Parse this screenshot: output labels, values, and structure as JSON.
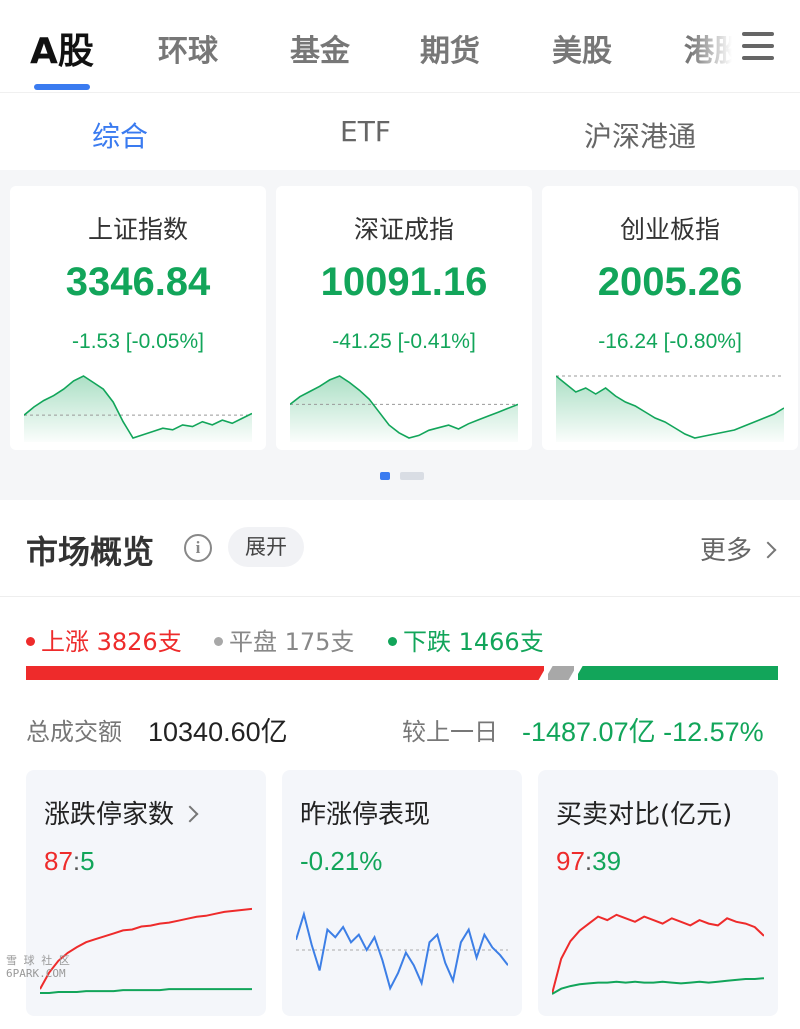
{
  "top_tabs": [
    {
      "label": "A股",
      "active": true
    },
    {
      "label": "环球",
      "active": false
    },
    {
      "label": "基金",
      "active": false
    },
    {
      "label": "期货",
      "active": false
    },
    {
      "label": "美股",
      "active": false
    },
    {
      "label": "港股",
      "active": false
    }
  ],
  "sub_tabs": [
    {
      "label": "综合",
      "active": true
    },
    {
      "label": "ETF",
      "active": false
    },
    {
      "label": "沪深港通",
      "active": false
    }
  ],
  "indices": [
    {
      "name": "上证指数",
      "value": "3346.84",
      "change": "-1.53 [-0.05%]"
    },
    {
      "name": "深证成指",
      "value": "10091.16",
      "change": "-41.25 [-0.41%]"
    },
    {
      "name": "创业板指",
      "value": "2005.26",
      "change": "-16.24 [-0.80%]"
    }
  ],
  "market": {
    "title": "市场概览",
    "expand_label": "展开",
    "more_label": "更多",
    "up_label": "上涨 3826支",
    "flat_label": "平盘 175支",
    "down_label": "下跌 1466支",
    "turnover_label": "总成交额",
    "turnover_value": "10340.60亿",
    "compare_label": "较上一日",
    "compare_value": "-1487.07亿 -12.57%"
  },
  "mini_cards": [
    {
      "title": "涨跌停家数",
      "value": "87:5"
    },
    {
      "title": "昨涨停表现",
      "value": "-0.21%"
    },
    {
      "title": "买卖对比(亿元)",
      "value": "97:39"
    }
  ],
  "watermark": {
    "line1": "雪 球 社 区",
    "line2": "6PARK.COM"
  },
  "colors": {
    "up": "#ee2b2b",
    "down": "#12a55a",
    "flat": "#a8a8a8",
    "accent": "#3a7bf0",
    "blue_line": "#3d7fe6"
  },
  "chart_data": [
    {
      "type": "line",
      "series": [
        {
          "values": [
            0,
            0.5,
            0.9,
            1.2,
            1.6,
            2.1,
            2.4,
            2.0,
            1.6,
            0.8,
            -0.4,
            -1.4,
            -1.2,
            -1.0,
            -0.8,
            -0.9,
            -0.6,
            -0.7,
            -0.4,
            -0.6,
            -0.3,
            -0.5,
            -0.2,
            0.1
          ]
        }
      ]
    },
    {
      "type": "line",
      "series": [
        {
          "values": [
            0,
            0.6,
            1.0,
            1.4,
            1.9,
            2.2,
            1.7,
            1.1,
            0.4,
            -0.6,
            -1.6,
            -2.2,
            -2.6,
            -2.4,
            -2.0,
            -1.8,
            -1.6,
            -1.9,
            -1.5,
            -1.2,
            -0.9,
            -0.6,
            -0.3,
            0.0
          ]
        }
      ]
    },
    {
      "type": "line",
      "series": [
        {
          "values": [
            0,
            -0.4,
            -0.8,
            -0.6,
            -0.9,
            -0.6,
            -1.0,
            -1.3,
            -1.5,
            -1.8,
            -2.1,
            -2.3,
            -2.6,
            -2.9,
            -3.1,
            -3.0,
            -2.9,
            -2.8,
            -2.7,
            -2.5,
            -2.3,
            -2.1,
            -1.9,
            -1.6
          ]
        }
      ]
    },
    {
      "type": "line",
      "series": [
        {
          "values": [
            5,
            22,
            34,
            42,
            48,
            53,
            56,
            59,
            62,
            65,
            66,
            69,
            70,
            72,
            73,
            75,
            77,
            79,
            80,
            82,
            84,
            85,
            86,
            87
          ]
        },
        {
          "values": [
            1,
            1,
            2,
            2,
            2,
            3,
            3,
            3,
            3,
            4,
            4,
            4,
            4,
            4,
            5,
            5,
            5,
            5,
            5,
            5,
            5,
            5,
            5,
            5
          ]
        }
      ]
    },
    {
      "type": "line",
      "series": [
        {
          "values": [
            0.4,
            1.4,
            0.2,
            -0.8,
            0.8,
            0.5,
            0.9,
            0.3,
            0.6,
            0.0,
            0.5,
            -0.4,
            -1.5,
            -0.9,
            -0.1,
            -0.6,
            -1.3,
            0.3,
            0.6,
            -0.5,
            -1.2,
            0.3,
            0.8,
            -0.3,
            0.6,
            0.1,
            -0.2,
            -0.6
          ]
        }
      ]
    },
    {
      "type": "line",
      "series": [
        {
          "values": [
            0,
            40,
            60,
            72,
            80,
            88,
            84,
            90,
            86,
            82,
            88,
            84,
            80,
            86,
            82,
            78,
            84,
            80,
            78,
            86,
            82,
            80,
            76,
            66
          ]
        },
        {
          "values": [
            0,
            6,
            9,
            11,
            12,
            13,
            13,
            14,
            13,
            14,
            13,
            13,
            14,
            13,
            12,
            13,
            14,
            13,
            14,
            15,
            16,
            17,
            17,
            18
          ]
        }
      ]
    }
  ]
}
